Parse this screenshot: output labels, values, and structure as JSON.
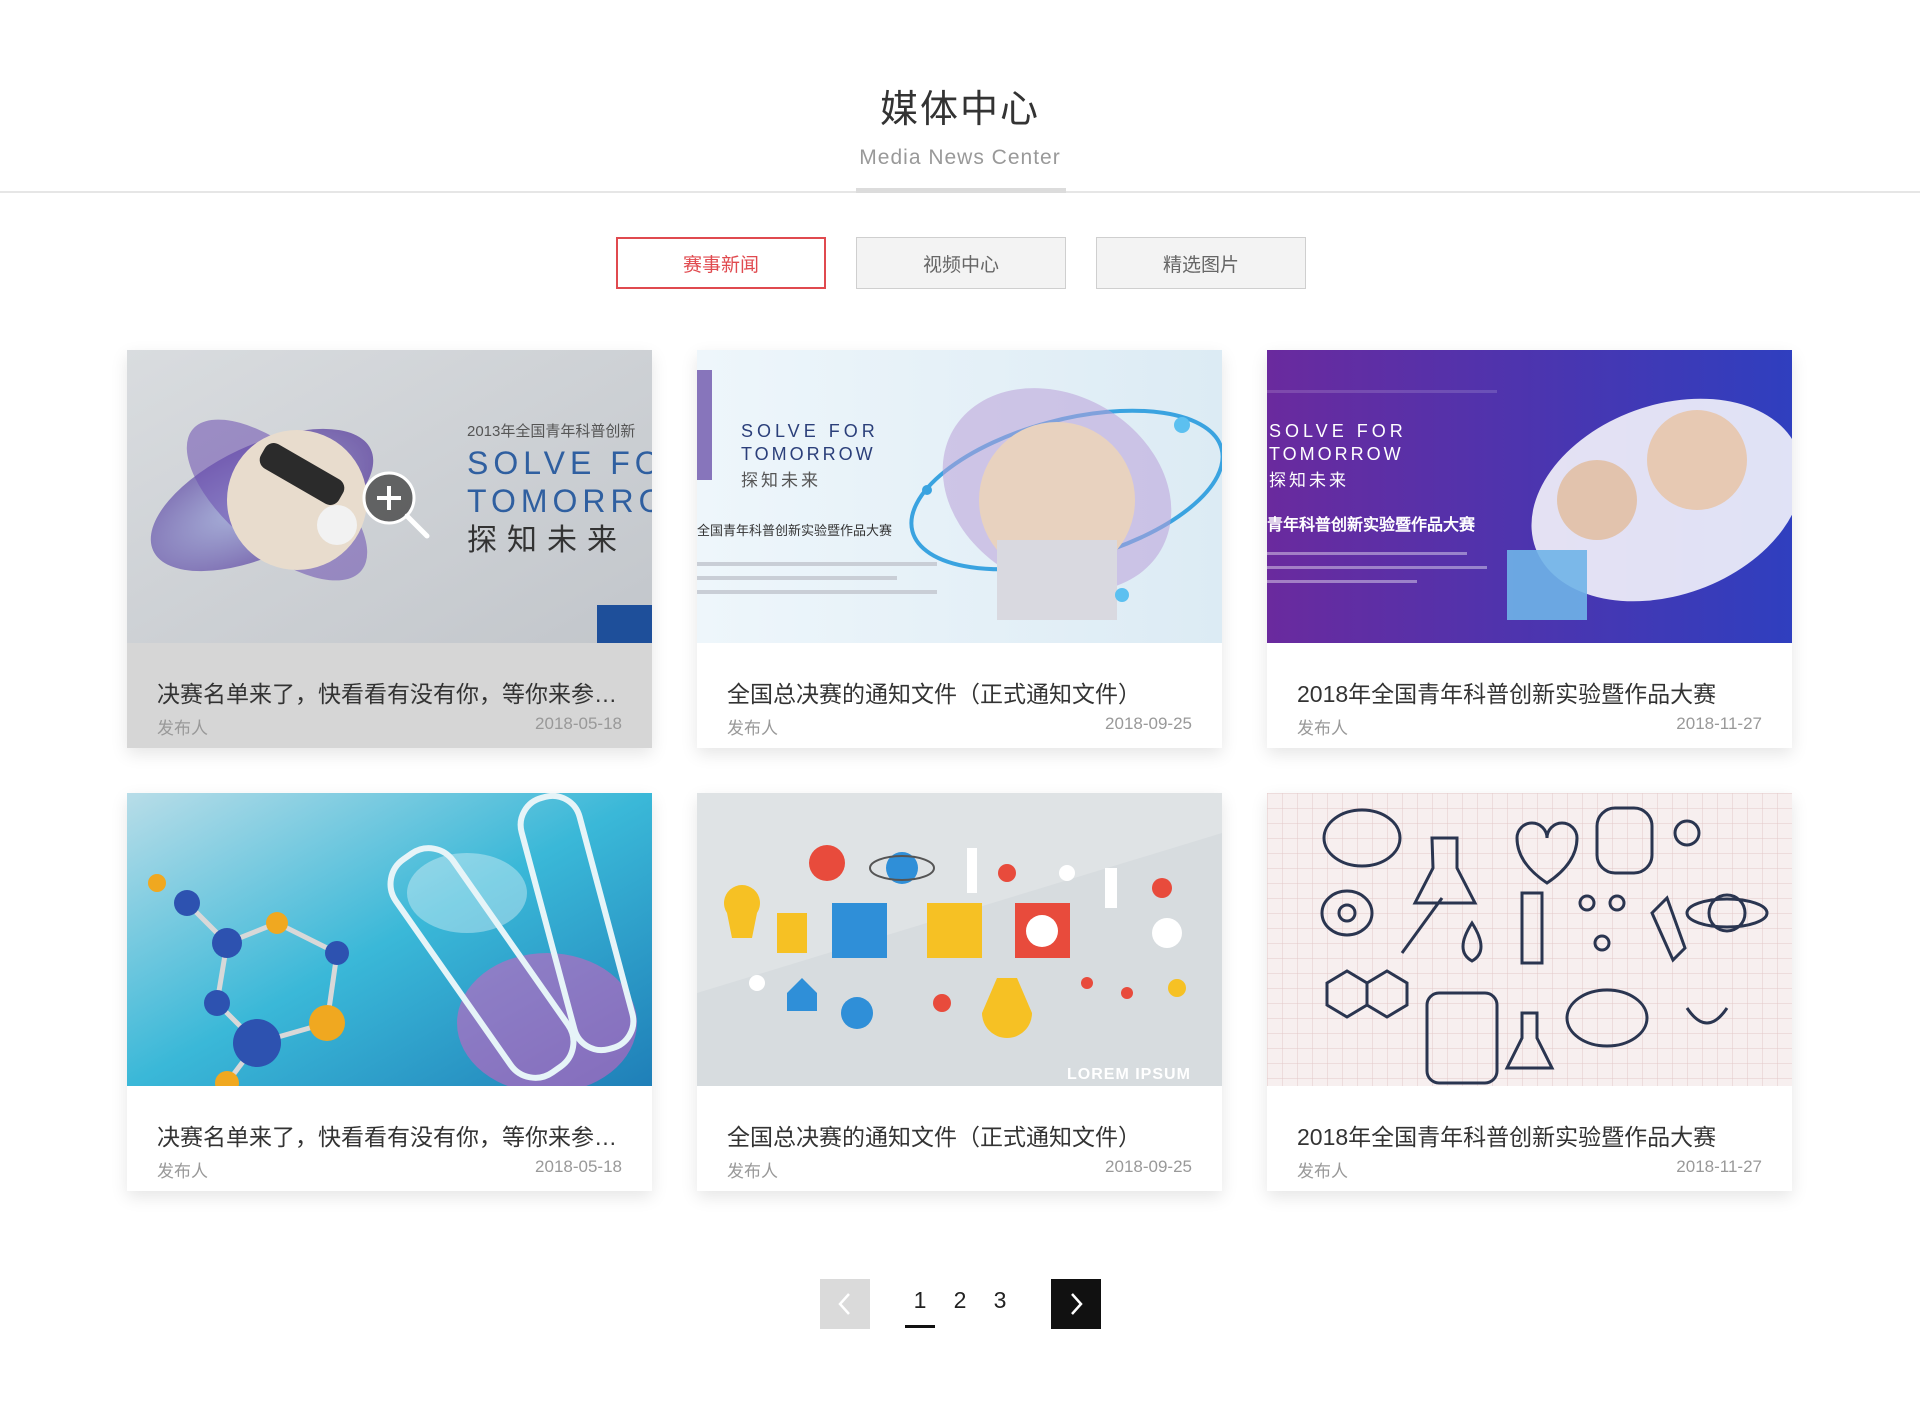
{
  "header": {
    "title": "媒体中心",
    "subtitle": "Media News Center"
  },
  "tabs": [
    {
      "label": "赛事新闻",
      "active": true
    },
    {
      "label": "视频中心",
      "active": false
    },
    {
      "label": "精选图片",
      "active": false
    }
  ],
  "cards": [
    {
      "title": "决赛名单来了，快看看有没有你，等你来参加...",
      "author": "发布人",
      "date": "2018-05-18",
      "image_text": {
        "line1": "2013年全国青年科普创新",
        "line2": "SOLVE FO",
        "line3": "TOMORRO",
        "line4": "探知未来"
      }
    },
    {
      "title": "全国总决赛的通知文件（正式通知文件）",
      "author": "发布人",
      "date": "2018-09-25",
      "image_text": {
        "line1": "SOLVE FOR",
        "line2": "TOMORROW",
        "line3": "探知未来",
        "line4": "全国青年科普创新实验暨作品大赛"
      }
    },
    {
      "title": "2018年全国青年科普创新实验暨作品大赛",
      "author": "发布人",
      "date": "2018-11-27",
      "image_text": {
        "line1": "SOLVE FOR",
        "line2": "TOMORROW",
        "line3": "探知未来",
        "line4": "青年科普创新实验暨作品大赛"
      }
    },
    {
      "title": "决赛名单来了，快看看有没有你，等你来参加...",
      "author": "发布人",
      "date": "2018-05-18"
    },
    {
      "title": "全国总决赛的通知文件（正式通知文件）",
      "author": "发布人",
      "date": "2018-09-25",
      "image_text": {
        "line1": "LOREM IPSUM"
      }
    },
    {
      "title": "2018年全国青年科普创新实验暨作品大赛",
      "author": "发布人",
      "date": "2018-11-27"
    }
  ],
  "pagination": {
    "pages": [
      "1",
      "2",
      "3"
    ],
    "current": "1",
    "icons": {
      "prev": "chevron-left-icon",
      "next": "chevron-right-icon"
    }
  },
  "colors": {
    "accent": "#e04a4f",
    "muted_text": "#999999",
    "hover_overlay": "#d6d6d6"
  }
}
